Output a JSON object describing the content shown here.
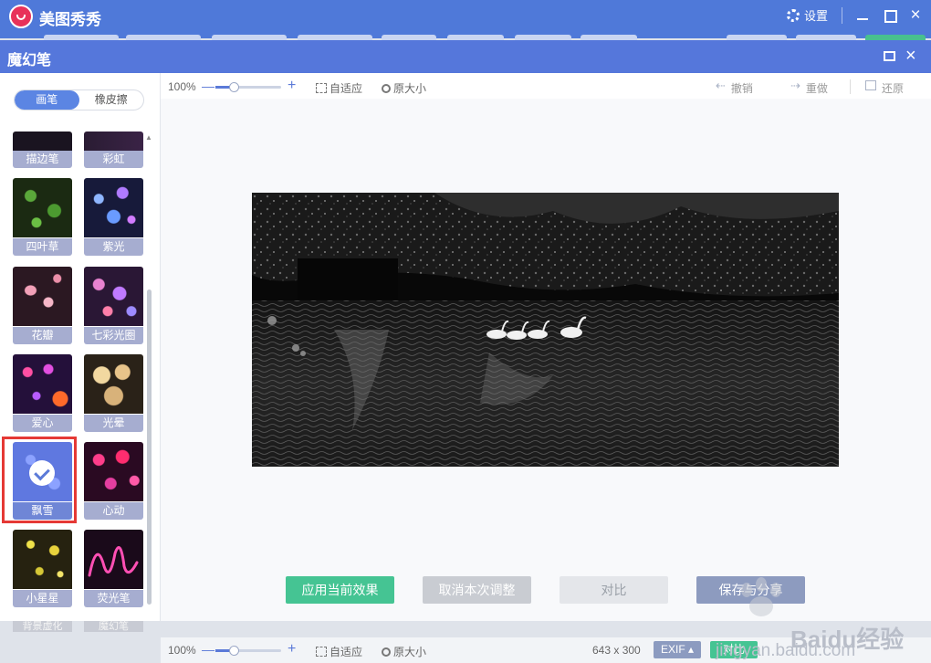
{
  "app": {
    "name": "美图秀秀",
    "settings_label": "设置"
  },
  "dialog": {
    "title": "魔幻笔"
  },
  "sidebar": {
    "tabs": [
      {
        "label": "画笔",
        "active": true
      },
      {
        "label": "橡皮擦",
        "active": false
      }
    ],
    "brushes": [
      {
        "label": "描边笔"
      },
      {
        "label": "彩虹"
      },
      {
        "label": "四叶草"
      },
      {
        "label": "紫光"
      },
      {
        "label": "花瓣"
      },
      {
        "label": "七彩光圈"
      },
      {
        "label": "爱心"
      },
      {
        "label": "光晕"
      },
      {
        "label": "飘雪",
        "selected": true
      },
      {
        "label": "心动"
      },
      {
        "label": "小星星"
      },
      {
        "label": "荧光笔"
      }
    ],
    "next_row": [
      "背景虚化",
      "魔幻笔"
    ]
  },
  "toolbar": {
    "zoom": "100%",
    "fit_label": "自适应",
    "original_label": "原大小",
    "undo_label": "撤销",
    "redo_label": "重做",
    "restore_label": "还原"
  },
  "actions": {
    "apply": "应用当前效果",
    "cancel": "取消本次调整",
    "compare": "对比",
    "save": "保存与分享"
  },
  "statusbar": {
    "zoom": "100%",
    "fit_label": "自适应",
    "original_label": "原大小",
    "dimensions": "643 x 300",
    "exif": "EXIF",
    "compare": "对比"
  },
  "watermark": {
    "text": "Baidu经验",
    "url": "jingyan.baidu.com"
  },
  "colors": {
    "titlebar": "#4f79d9",
    "dialog_header": "#5577db",
    "accent_green": "#45c493",
    "highlight_red": "#e53935"
  }
}
